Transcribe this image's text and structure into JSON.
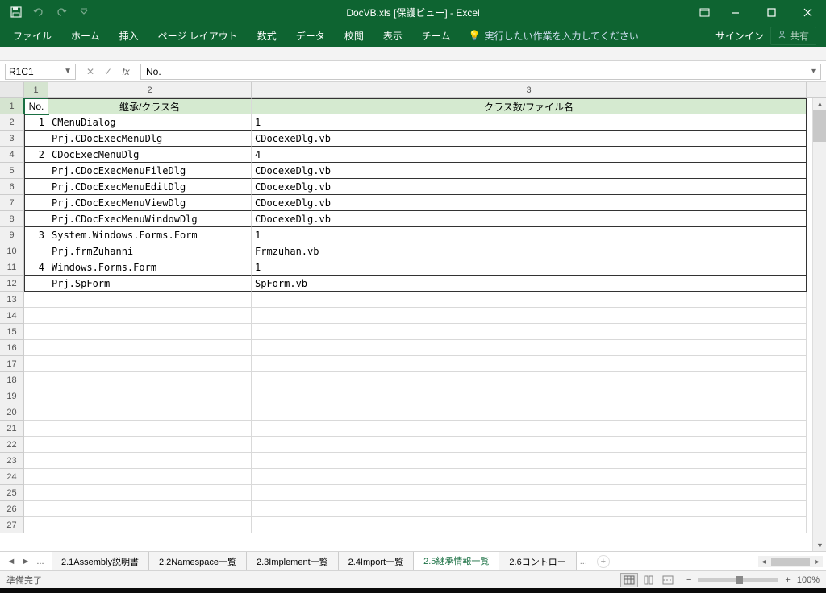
{
  "title": "DocVB.xls  [保護ビュー] - Excel",
  "qat": {
    "undo": "↶",
    "redo": "↷"
  },
  "ribbon": {
    "tabs": [
      "ファイル",
      "ホーム",
      "挿入",
      "ページ レイアウト",
      "数式",
      "データ",
      "校閲",
      "表示",
      "チーム"
    ],
    "tellme": "実行したい作業を入力してください",
    "signin": "サインイン",
    "share": "共有"
  },
  "namebox": "R1C1",
  "formula": "No.",
  "colnums": [
    "1",
    "2",
    "3"
  ],
  "headers": {
    "c1": "No.",
    "c2": "継承/クラス名",
    "c3": "クラス数/ファイル名"
  },
  "rows": [
    {
      "n": "1",
      "a": "CMenuDialog",
      "b": "1"
    },
    {
      "n": "",
      "a": "Prj.CDocExecMenuDlg",
      "b": "CDocexeDlg.vb"
    },
    {
      "n": "2",
      "a": "CDocExecMenuDlg",
      "b": "4"
    },
    {
      "n": "",
      "a": "Prj.CDocExecMenuFileDlg",
      "b": "CDocexeDlg.vb"
    },
    {
      "n": "",
      "a": "Prj.CDocExecMenuEditDlg",
      "b": "CDocexeDlg.vb"
    },
    {
      "n": "",
      "a": "Prj.CDocExecMenuViewDlg",
      "b": "CDocexeDlg.vb"
    },
    {
      "n": "",
      "a": "Prj.CDocExecMenuWindowDlg",
      "b": "CDocexeDlg.vb"
    },
    {
      "n": "3",
      "a": "System.Windows.Forms.Form",
      "b": "1"
    },
    {
      "n": "",
      "a": "Prj.frmZuhanni",
      "b": "Frmzuhan.vb"
    },
    {
      "n": "4",
      "a": "Windows.Forms.Form",
      "b": "1"
    },
    {
      "n": "",
      "a": "Prj.SpForm",
      "b": "SpForm.vb"
    }
  ],
  "empty_rows": [
    "13",
    "14",
    "15",
    "16",
    "17",
    "18",
    "19",
    "20",
    "21",
    "22",
    "23",
    "24",
    "25",
    "26",
    "27"
  ],
  "sheets": {
    "dots": "...",
    "tabs": [
      "2.1Assembly説明書",
      "2.2Namespace一覧",
      "2.3Implement一覧",
      "2.4Import一覧",
      "2.5継承情報一覧",
      "2.6コントロー"
    ],
    "more": "...",
    "active": 4
  },
  "status": "準備完了",
  "zoom": "100%"
}
